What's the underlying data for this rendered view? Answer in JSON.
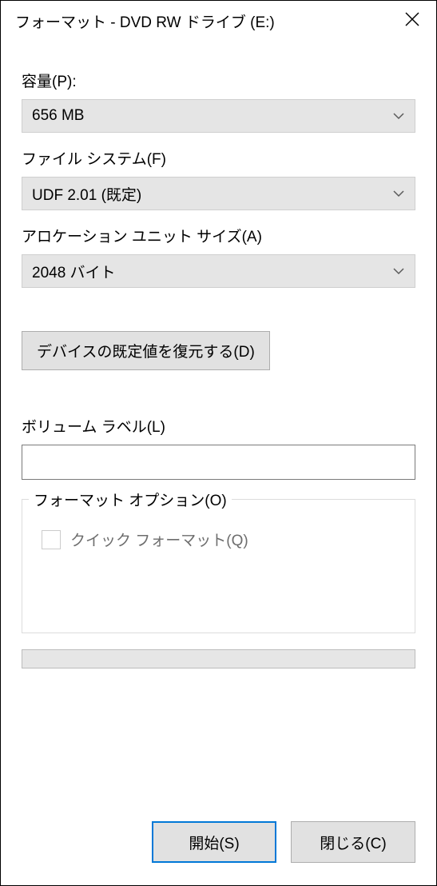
{
  "title": "フォーマット - DVD RW ドライブ (E:)",
  "capacity": {
    "label": "容量(P):",
    "value": "656 MB"
  },
  "filesystem": {
    "label": "ファイル システム(F)",
    "value": "UDF 2.01 (既定)"
  },
  "allocation": {
    "label": "アロケーション ユニット サイズ(A)",
    "value": "2048 バイト"
  },
  "restore_button": "デバイスの既定値を復元する(D)",
  "volume": {
    "label": "ボリューム ラベル(L)",
    "value": ""
  },
  "options_group": {
    "legend": "フォーマット オプション(O)",
    "quick_format": "クイック フォーマット(Q)"
  },
  "buttons": {
    "start": "開始(S)",
    "close": "閉じる(C)"
  }
}
